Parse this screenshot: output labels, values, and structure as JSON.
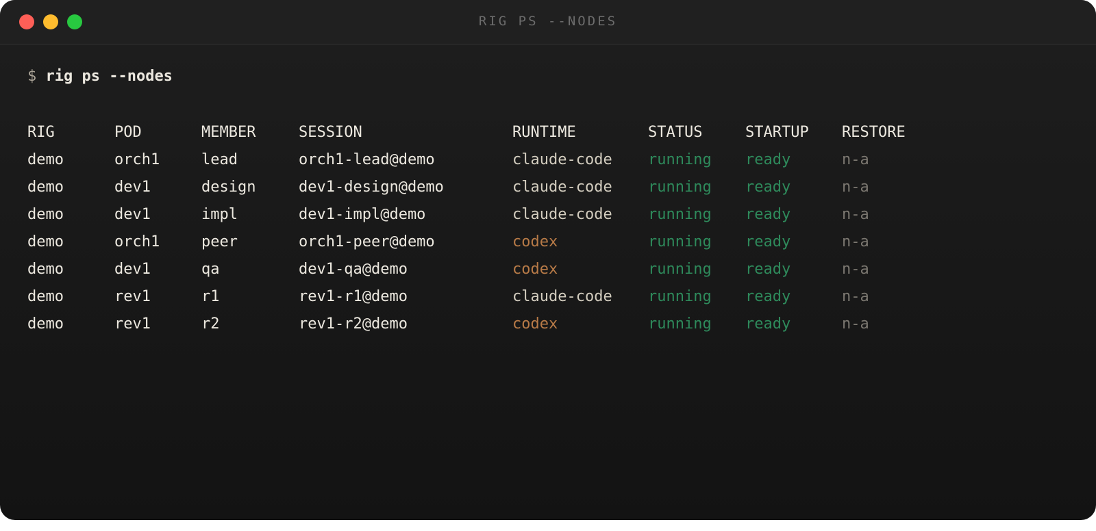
{
  "window": {
    "title": "RIG PS --NODES"
  },
  "terminal": {
    "prompt_symbol": "$",
    "command": "rig ps --nodes",
    "columns": [
      "RIG",
      "POD",
      "MEMBER",
      "SESSION",
      "RUNTIME",
      "STATUS",
      "STARTUP",
      "RESTORE"
    ],
    "rows": [
      {
        "rig": "demo",
        "pod": "orch1",
        "member": "lead",
        "session": "orch1-lead@demo",
        "runtime": "claude-code",
        "status": "running",
        "startup": "ready",
        "restore": "n-a"
      },
      {
        "rig": "demo",
        "pod": "dev1",
        "member": "design",
        "session": "dev1-design@demo",
        "runtime": "claude-code",
        "status": "running",
        "startup": "ready",
        "restore": "n-a"
      },
      {
        "rig": "demo",
        "pod": "dev1",
        "member": "impl",
        "session": "dev1-impl@demo",
        "runtime": "claude-code",
        "status": "running",
        "startup": "ready",
        "restore": "n-a"
      },
      {
        "rig": "demo",
        "pod": "orch1",
        "member": "peer",
        "session": "orch1-peer@demo",
        "runtime": "codex",
        "status": "running",
        "startup": "ready",
        "restore": "n-a"
      },
      {
        "rig": "demo",
        "pod": "dev1",
        "member": "qa",
        "session": "dev1-qa@demo",
        "runtime": "codex",
        "status": "running",
        "startup": "ready",
        "restore": "n-a"
      },
      {
        "rig": "demo",
        "pod": "rev1",
        "member": "r1",
        "session": "rev1-r1@demo",
        "runtime": "claude-code",
        "status": "running",
        "startup": "ready",
        "restore": "n-a"
      },
      {
        "rig": "demo",
        "pod": "rev1",
        "member": "r2",
        "session": "rev1-r2@demo",
        "runtime": "codex",
        "status": "running",
        "startup": "ready",
        "restore": "n-a"
      }
    ]
  },
  "colors": {
    "window_bg": "#1a1a1a",
    "text": "#ece8df",
    "claude_code": "#d3cdbf",
    "codex": "#b77a47",
    "ok_green": "#2e8a5b",
    "muted": "#7b7770",
    "close": "#ff5f57",
    "minimize": "#febc2e",
    "zoom": "#28c840"
  }
}
